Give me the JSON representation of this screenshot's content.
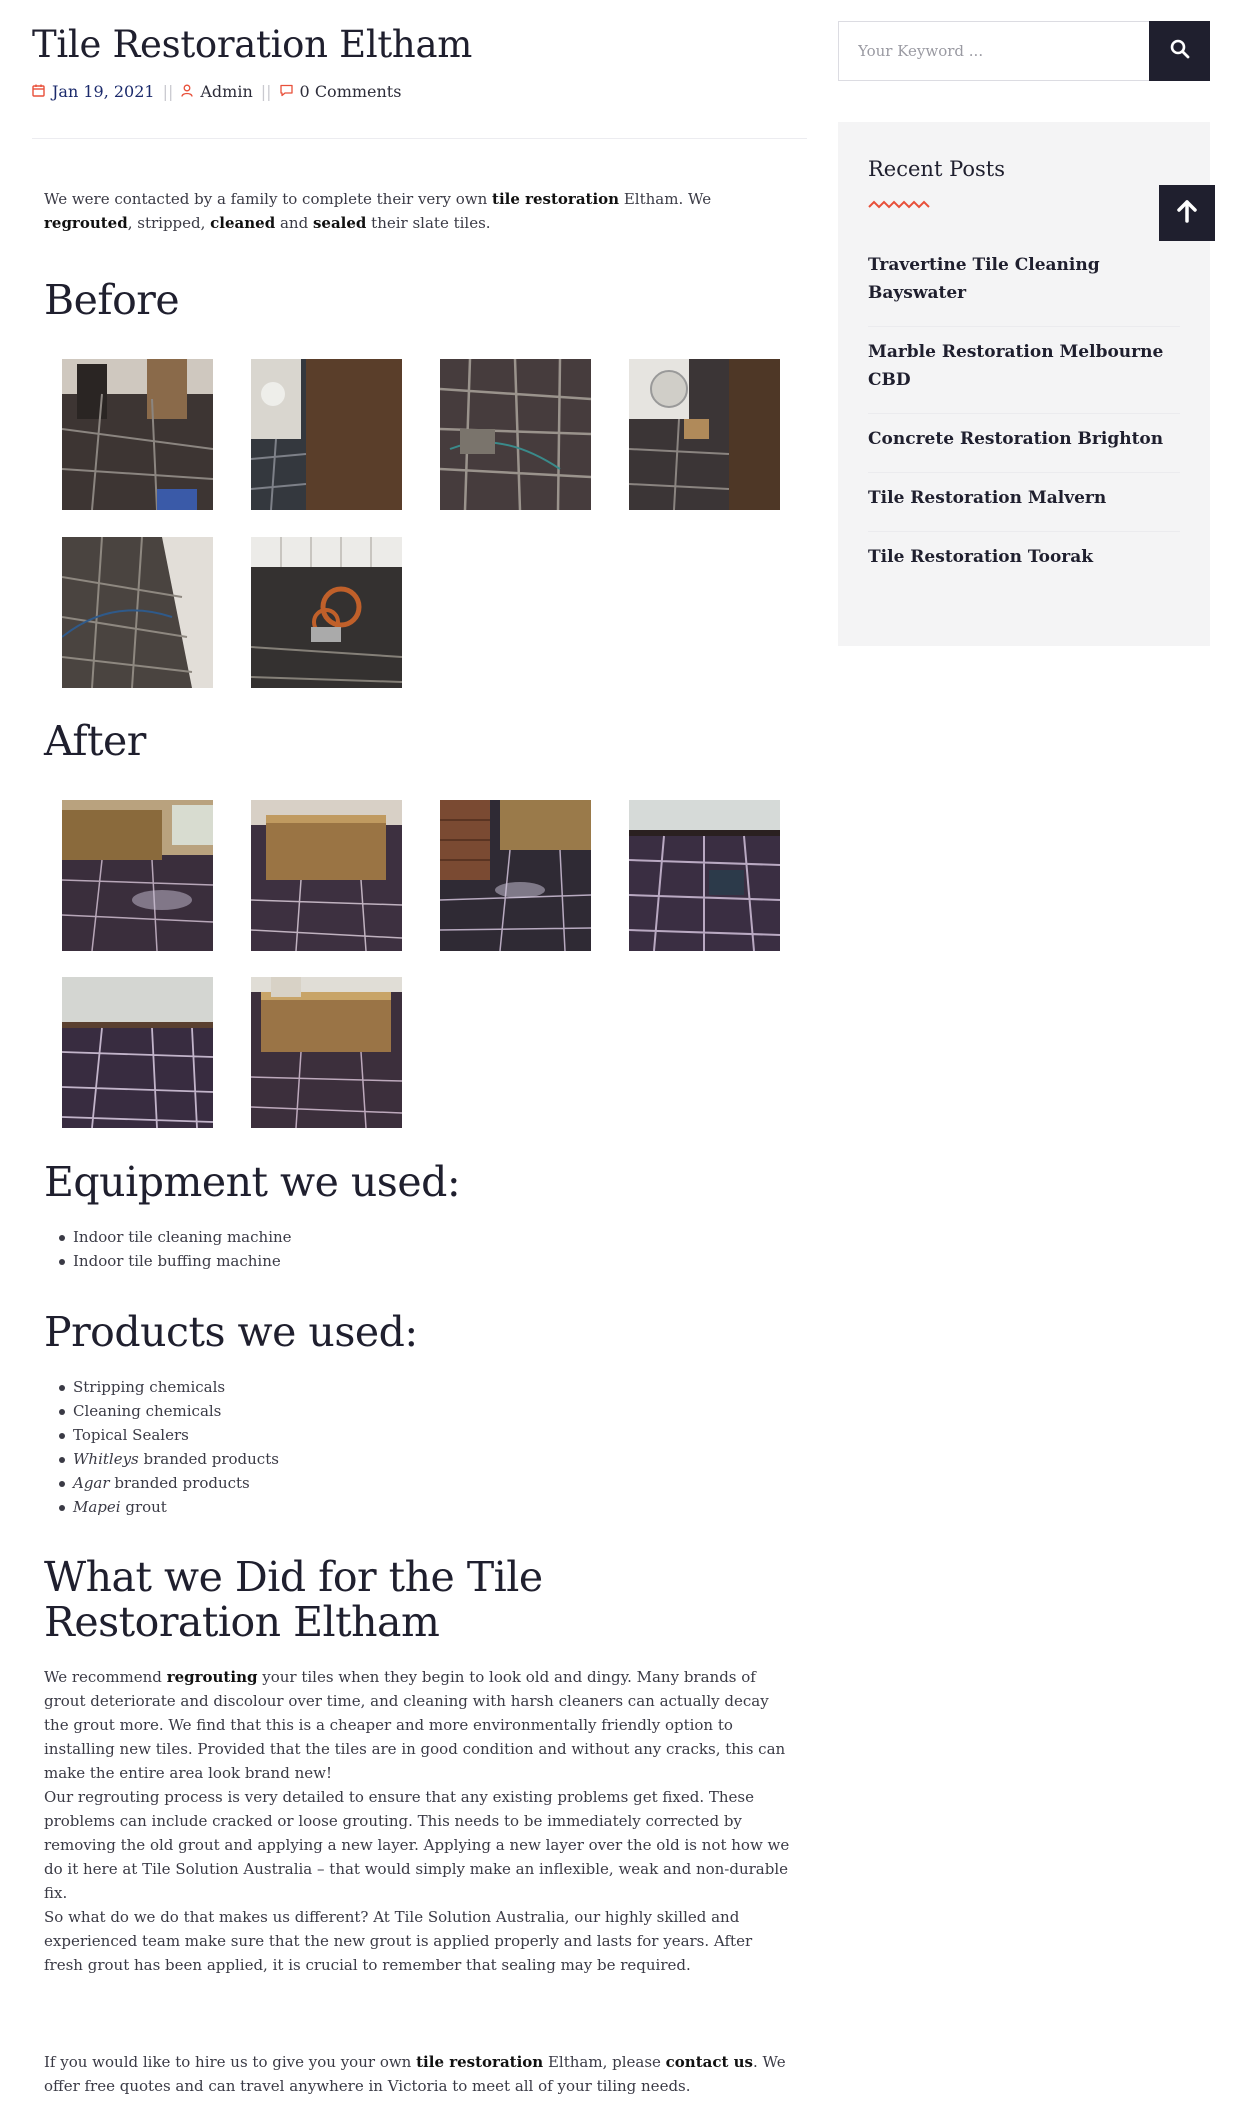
{
  "post": {
    "title": "Tile Restoration Eltham",
    "meta": {
      "date": "Jan 19, 2021",
      "separator": "||",
      "author": "Admin",
      "comments": "0 Comments"
    },
    "intro": {
      "t1": "We were contacted by a family to complete their very own ",
      "b1": "tile restoration",
      "t2": " Eltham. We ",
      "b2": "regrouted",
      "t3": ", stripped, ",
      "b3": "cleaned",
      "t4": " and ",
      "b4": "sealed",
      "t5": " their slate tiles."
    },
    "before_heading": "Before",
    "after_heading": "After",
    "equipment_heading": "Equipment we used:",
    "equipment": [
      "Indoor tile cleaning machine",
      "Indoor tile buffing machine"
    ],
    "products_heading": "Products we used:",
    "products": [
      {
        "em": "",
        "text": "Stripping chemicals"
      },
      {
        "em": "",
        "text": "Cleaning chemicals"
      },
      {
        "em": "",
        "text": "Topical Sealers"
      },
      {
        "em": "Whitleys",
        "text": " branded products"
      },
      {
        "em": "Agar",
        "text": " branded products"
      },
      {
        "em": "Mapei",
        "text": " grout"
      }
    ],
    "what_heading": "What we Did for the Tile Restoration Eltham",
    "para1": {
      "t1": "We recommend ",
      "b1": "regrouting",
      "t2": " your tiles when they begin to look old and dingy. Many brands of grout deteriorate and discolour over time, and cleaning with harsh cleaners can actually decay the grout more. We find that this is a cheaper and more environmentally friendly option to installing new tiles. Provided that the tiles are in good condition and without any cracks, this can make the entire area look brand new!"
    },
    "para2": "Our regrouting process is very detailed to ensure that any existing problems get fixed. These problems can include cracked or loose grouting. This needs to be immediately corrected by removing the old grout and applying a new layer. Applying a new layer over the old is not how we do it here at Tile Solution Australia – that would simply make an inflexible, weak and non-durable fix.",
    "para3": "So what do we do that makes us different? At Tile Solution Australia, our highly skilled and experienced team make sure that the new grout is applied properly and lasts for years. After fresh grout has been applied, it is crucial to remember that sealing may be required.",
    "para4": {
      "t1": "If you would like to hire us to give you your own ",
      "b1": "tile restoration",
      "t2": " Eltham, please ",
      "b2": "contact us",
      "t3": ". We offer free quotes and can travel anywhere in Victoria to meet all of your tiling needs."
    }
  },
  "search": {
    "placeholder": "Your Keyword ..."
  },
  "sidebar": {
    "recent_title": "Recent Posts",
    "recent_posts": [
      "Travertine Tile Cleaning Bayswater",
      "Marble Restoration Melbourne CBD",
      "Concrete Restoration Brighton",
      "Tile Restoration Malvern",
      "Tile Restoration Toorak"
    ]
  },
  "colors": {
    "accent": "#e8503a",
    "dark": "#1f1f2e",
    "date_link": "#1b2a6b",
    "sidebar_bg": "#f4f4f5"
  },
  "icons": [
    "calendar-icon",
    "user-icon",
    "comment-icon",
    "search-icon",
    "arrow-up-icon",
    "wave-underline"
  ]
}
